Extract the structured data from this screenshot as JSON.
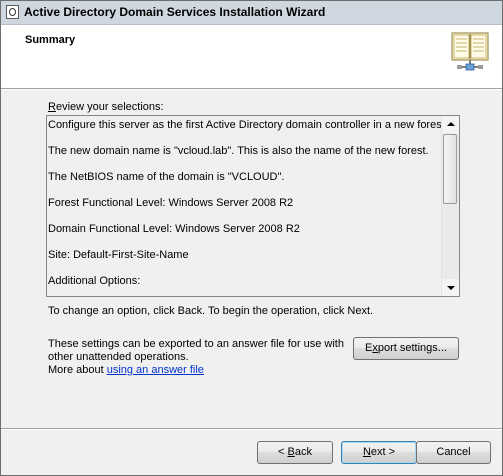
{
  "window": {
    "title": "Active Directory Domain Services Installation Wizard"
  },
  "header": {
    "title": "Summary",
    "icon": "book-server-icon"
  },
  "review": {
    "label": "Review your selections:",
    "lines": [
      "Configure this server as the first Active Directory domain controller in a new forest.",
      "The new domain name is \"vcloud.lab\". This is also the name of the new forest.",
      "The NetBIOS name of the domain is \"VCLOUD\".",
      "Forest Functional Level: Windows Server 2008 R2",
      "Domain Functional Level: Windows Server 2008 R2",
      "Site: Default-First-Site-Name",
      "Additional Options:"
    ]
  },
  "hint": {
    "change": "To change an option, click Back. To begin the operation, click Next."
  },
  "export": {
    "text": "These settings can be exported to an answer file for use with other unattended operations.",
    "more_prefix": "More about ",
    "link": "using an answer file",
    "button": "Export settings..."
  },
  "buttons": {
    "back": "< Back",
    "next": "Next >",
    "cancel": "Cancel"
  },
  "colors": {
    "link": "#0033cc",
    "dialog_bg": "#f0f0f0",
    "titlebar": "#cfd7e0"
  }
}
